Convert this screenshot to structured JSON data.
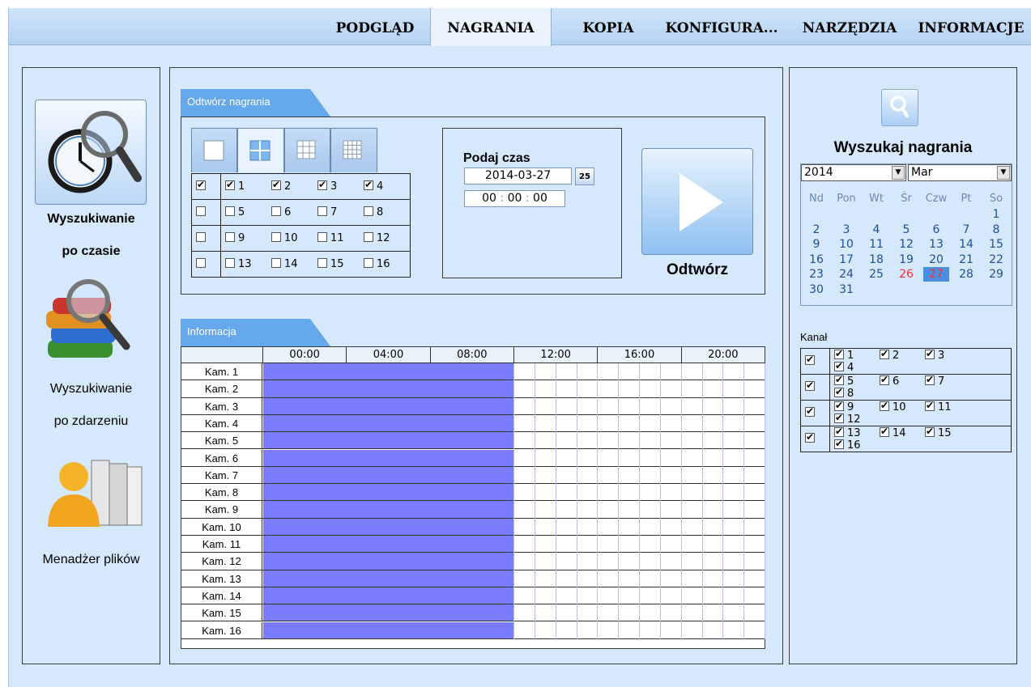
{
  "nav": {
    "tabs": [
      {
        "label": "PODGLĄD",
        "active": false
      },
      {
        "label": "NAGRANIA",
        "active": true
      },
      {
        "label": "KOPIA",
        "active": false
      },
      {
        "label": "KONFIGURA...",
        "active": false
      },
      {
        "label": "NARZĘDZIA",
        "active": false
      },
      {
        "label": "INFORMACJE",
        "active": false
      }
    ]
  },
  "left": {
    "items": [
      {
        "label1": "Wyszukiwanie",
        "label2": "po czasie",
        "selected": true
      },
      {
        "label1": "Wyszukiwanie",
        "label2": "po zdarzeniu",
        "selected": false
      },
      {
        "label1": "Menadżer plików",
        "selected": false
      }
    ]
  },
  "playback": {
    "title": "Odtwórz nagrania",
    "channels_rows": [
      {
        "all": true,
        "channels": [
          {
            "n": "1",
            "on": true
          },
          {
            "n": "2",
            "on": true
          },
          {
            "n": "3",
            "on": true
          },
          {
            "n": "4",
            "on": true
          }
        ]
      },
      {
        "all": false,
        "channels": [
          {
            "n": "5",
            "on": false
          },
          {
            "n": "6",
            "on": false
          },
          {
            "n": "7",
            "on": false
          },
          {
            "n": "8",
            "on": false
          }
        ]
      },
      {
        "all": false,
        "channels": [
          {
            "n": "9",
            "on": false
          },
          {
            "n": "10",
            "on": false
          },
          {
            "n": "11",
            "on": false
          },
          {
            "n": "12",
            "on": false
          }
        ]
      },
      {
        "all": false,
        "channels": [
          {
            "n": "13",
            "on": false
          },
          {
            "n": "14",
            "on": false
          },
          {
            "n": "15",
            "on": false
          },
          {
            "n": "16",
            "on": false
          }
        ]
      }
    ],
    "time_title": "Podaj czas",
    "date_value": "2014-03-27",
    "calendar_icon_text": "25",
    "time_h": "00",
    "time_m": "00",
    "time_s": "00",
    "play_label": "Odtwórz"
  },
  "info": {
    "title": "Informacja",
    "hours": [
      "00:00",
      "04:00",
      "08:00",
      "12:00",
      "16:00",
      "20:00"
    ],
    "cameras": [
      "Kam. 1",
      "Kam. 2",
      "Kam. 3",
      "Kam. 4",
      "Kam. 5",
      "Kam. 6",
      "Kam. 7",
      "Kam. 8",
      "Kam. 9",
      "Kam. 10",
      "Kam. 11",
      "Kam. 12",
      "Kam. 13",
      "Kam. 14",
      "Kam. 15",
      "Kam. 16"
    ],
    "recorded_until_hour": 12,
    "record_color": "#7b7bff"
  },
  "search": {
    "title": "Wyszukaj nagrania",
    "year": "2014",
    "month": "Mar",
    "weekdays": [
      "Nd",
      "Pon",
      "Wt",
      "Śr",
      "Czw",
      "Pt",
      "So"
    ],
    "first_weekday_index": 6,
    "days_in_month": 31,
    "recorded_days": [
      "26"
    ],
    "selected_day": "27",
    "channel_label": "Kanał",
    "channel_rows": [
      {
        "all": true,
        "channels": [
          {
            "n": "1",
            "on": true
          },
          {
            "n": "2",
            "on": true
          },
          {
            "n": "3",
            "on": true
          },
          {
            "n": "4",
            "on": true
          }
        ]
      },
      {
        "all": true,
        "channels": [
          {
            "n": "5",
            "on": true
          },
          {
            "n": "6",
            "on": true
          },
          {
            "n": "7",
            "on": true
          },
          {
            "n": "8",
            "on": true
          }
        ]
      },
      {
        "all": true,
        "channels": [
          {
            "n": "9",
            "on": true
          },
          {
            "n": "10",
            "on": true
          },
          {
            "n": "11",
            "on": true
          },
          {
            "n": "12",
            "on": true
          }
        ]
      },
      {
        "all": true,
        "channels": [
          {
            "n": "13",
            "on": true
          },
          {
            "n": "14",
            "on": true
          },
          {
            "n": "15",
            "on": true
          },
          {
            "n": "16",
            "on": true
          }
        ]
      }
    ]
  }
}
